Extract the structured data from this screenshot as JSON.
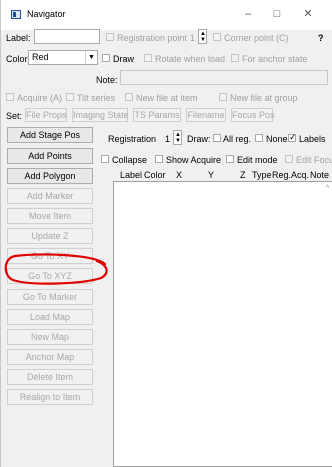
{
  "window": {
    "title": "Navigator",
    "minimize": "–",
    "maximize": "□",
    "close": "✕"
  },
  "top": {
    "label_label": "Label:",
    "registration_point": "Registration point",
    "registration_value": "1",
    "corner_point": "Corner point (C)",
    "help": "?",
    "color_label": "Color",
    "color_value": "Red",
    "draw": "Draw",
    "rotate_when_load": "Rotate when load",
    "for_anchor_state": "For anchor state",
    "note_label": "Note:",
    "acquire": "Acquire (A)",
    "tilt_series": "Tilt series",
    "new_file_at_item": "New file at item",
    "new_file_at_group": "New file at group",
    "set_label": "Set:",
    "set_buttons": [
      "File Props",
      "Imaging State",
      "TS Params",
      "Filename",
      "Focus Pos"
    ]
  },
  "side_buttons": [
    {
      "label": "Add Stage Pos",
      "enabled": true
    },
    {
      "label": "Add Points",
      "enabled": true
    },
    {
      "label": "Add Polygon",
      "enabled": true
    },
    {
      "label": "Add Marker",
      "enabled": false
    },
    {
      "label": "Move Item",
      "enabled": false
    },
    {
      "label": "Update Z",
      "enabled": false
    },
    {
      "label": "Go To XY",
      "enabled": false
    },
    {
      "label": "Go To XYZ",
      "enabled": false
    },
    {
      "label": "Go To Marker",
      "enabled": false
    },
    {
      "label": "Load Map",
      "enabled": false
    },
    {
      "label": "New Map",
      "enabled": false
    },
    {
      "label": "Anchor Map",
      "enabled": false
    },
    {
      "label": "Delete Item",
      "enabled": false
    },
    {
      "label": "Realign to Item",
      "enabled": false
    }
  ],
  "registration_bar": {
    "registration_label": "Registration",
    "registration_value": "1",
    "draw_label": "Draw:",
    "all_reg": "All reg.",
    "none": "None",
    "labels": "Labels",
    "labels_checked": true
  },
  "options_bar": {
    "collapse": "Collapse",
    "show_acquire": "Show Acquire",
    "edit_mode": "Edit mode",
    "edit_focus": "Edit Focus"
  },
  "list_header": {
    "columns": [
      "Label",
      "Color",
      "X",
      "Y",
      "Z",
      "Type",
      "Reg.",
      "Acq.",
      "Note"
    ]
  },
  "annotation": {
    "color": "#e00000",
    "target": "Update Z"
  }
}
